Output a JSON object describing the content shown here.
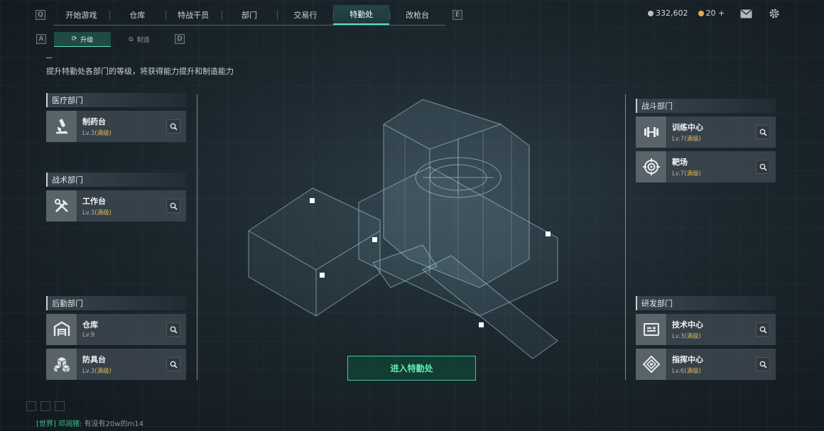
{
  "nav": {
    "key_left": "Q",
    "key_right": "E",
    "tabs": [
      {
        "label": "开始游戏"
      },
      {
        "label": "仓库"
      },
      {
        "label": "特战干员"
      },
      {
        "label": "部门"
      },
      {
        "label": "交易行"
      },
      {
        "label": "特勤处"
      },
      {
        "label": "改枪台"
      }
    ],
    "active_tab": "特勤处"
  },
  "currency": {
    "silver": "332,602",
    "gold": "20",
    "gold_plus": "+"
  },
  "subtabs": {
    "key_left": "A",
    "key_right": "D",
    "upgrade_label": "升级",
    "craft_label": "制造"
  },
  "description": "提升特勤处各部门的等级，将获得能力提升和制造能力",
  "departments": {
    "medical": {
      "title": "医疗部门",
      "facilities": [
        {
          "name": "制药台",
          "level": "Lv.3",
          "max": "(满级)",
          "icon": "microscope-icon"
        }
      ]
    },
    "tactical": {
      "title": "战术部门",
      "facilities": [
        {
          "name": "工作台",
          "level": "Lv.3",
          "max": "(满级)",
          "icon": "tools-icon"
        }
      ]
    },
    "logistics": {
      "title": "后勤部门",
      "facilities": [
        {
          "name": "仓库",
          "level": "Lv.9",
          "max": "",
          "icon": "warehouse-icon"
        },
        {
          "name": "防具台",
          "level": "Lv.3",
          "max": "(满级)",
          "icon": "boxes-icon"
        }
      ]
    },
    "combat": {
      "title": "战斗部门",
      "facilities": [
        {
          "name": "训练中心",
          "level": "Lv.7",
          "max": "(满级)",
          "icon": "dumbbell-icon"
        },
        {
          "name": "靶场",
          "level": "Lv.7",
          "max": "(满级)",
          "icon": "target-icon"
        }
      ]
    },
    "research": {
      "title": "研发部门",
      "facilities": [
        {
          "name": "技术中心",
          "level": "Lv.3",
          "max": "(满级)",
          "icon": "tech-icon"
        },
        {
          "name": "指挥中心",
          "level": "Lv.6",
          "max": "(满级)",
          "icon": "command-icon"
        }
      ]
    }
  },
  "enter_button": "进入特勤处",
  "chat": {
    "channel": "[世界]",
    "user": "邓润猪",
    "message": "有没有20w的m14"
  },
  "colors": {
    "accent": "#5fe0b8",
    "max_level": "#e0b84c",
    "panel": "#3e4850"
  }
}
